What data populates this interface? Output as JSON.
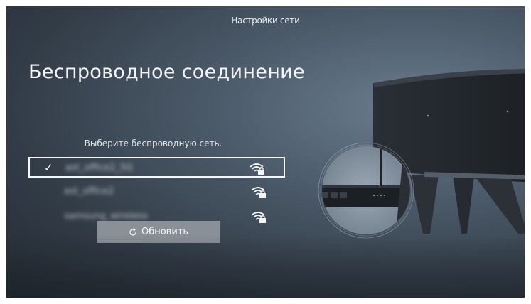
{
  "header": {
    "title": "Настройки сети"
  },
  "page": {
    "heading": "Беспроводное соединение",
    "prompt": "Выберите беспроводную сеть."
  },
  "networks": [
    {
      "name": "ast_office2_5G",
      "selected": true,
      "secured": true
    },
    {
      "name": "ast_office2",
      "selected": false,
      "secured": true
    },
    {
      "name": "samsung_wireless",
      "selected": false,
      "secured": true
    }
  ],
  "actions": {
    "refresh_label": "Обновить",
    "refresh_icon": "refresh-icon"
  },
  "icons": {
    "check": "✓",
    "wifi": "wifi-lock-icon"
  },
  "colors": {
    "background": "#3e4a57",
    "button": "#8a9097",
    "text": "#f2f4f6"
  }
}
